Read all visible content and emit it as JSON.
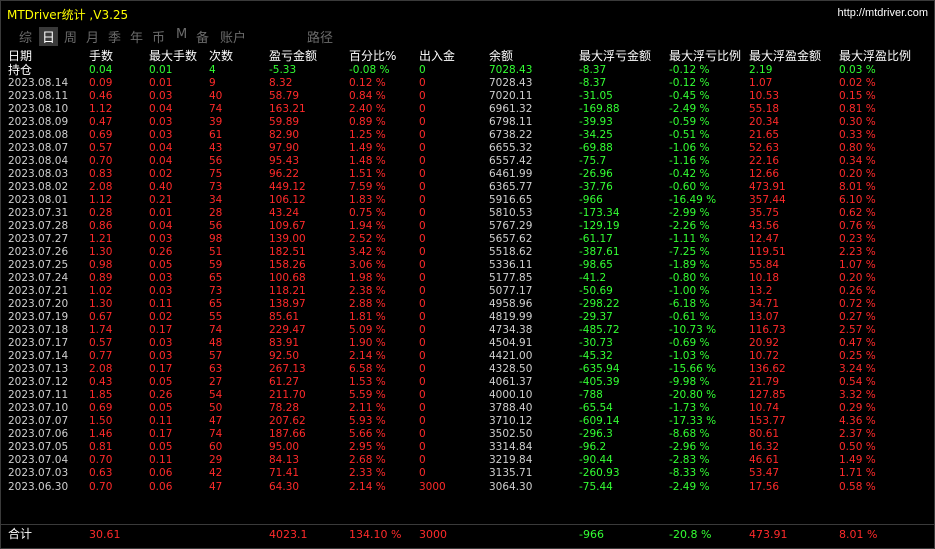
{
  "app": {
    "title": "MTDriver统计 ,V3.25",
    "url": "http://mtdriver.com"
  },
  "tabs": [
    "综",
    "日",
    "周",
    "月",
    "季",
    "年",
    "币",
    "M",
    "备",
    "账户",
    "路径"
  ],
  "active_tab": "日",
  "columns": [
    "日期",
    "手数",
    "最大手数",
    "次数",
    "盈亏金额",
    "百分比%",
    "出入金",
    "余额",
    "最大浮亏金额",
    "最大浮亏比例",
    "最大浮盈金额",
    "最大浮盈比例"
  ],
  "holding": [
    "持仓",
    "0.04",
    "0.01",
    "4",
    "-5.33",
    "-0.08 %",
    "0",
    "7028.43",
    "-8.37",
    "-0.12 %",
    "2.19",
    "0.03 %"
  ],
  "rows": [
    [
      "2023.08.14",
      "0.09",
      "0.01",
      "9",
      "8.32",
      "0.12 %",
      "0",
      "7028.43",
      "-8.37",
      "-0.12 %",
      "1.07",
      "0.02 %"
    ],
    [
      "2023.08.11",
      "0.46",
      "0.03",
      "40",
      "58.79",
      "0.84 %",
      "0",
      "7020.11",
      "-31.05",
      "-0.45 %",
      "10.53",
      "0.15 %"
    ],
    [
      "2023.08.10",
      "1.12",
      "0.04",
      "74",
      "163.21",
      "2.40 %",
      "0",
      "6961.32",
      "-169.88",
      "-2.49 %",
      "55.18",
      "0.81 %"
    ],
    [
      "2023.08.09",
      "0.47",
      "0.03",
      "39",
      "59.89",
      "0.89 %",
      "0",
      "6798.11",
      "-39.93",
      "-0.59 %",
      "20.34",
      "0.30 %"
    ],
    [
      "2023.08.08",
      "0.69",
      "0.03",
      "61",
      "82.90",
      "1.25 %",
      "0",
      "6738.22",
      "-34.25",
      "-0.51 %",
      "21.65",
      "0.33 %"
    ],
    [
      "2023.08.07",
      "0.57",
      "0.04",
      "43",
      "97.90",
      "1.49 %",
      "0",
      "6655.32",
      "-69.88",
      "-1.06 %",
      "52.63",
      "0.80 %"
    ],
    [
      "2023.08.04",
      "0.70",
      "0.04",
      "56",
      "95.43",
      "1.48 %",
      "0",
      "6557.42",
      "-75.7",
      "-1.16 %",
      "22.16",
      "0.34 %"
    ],
    [
      "2023.08.03",
      "0.83",
      "0.02",
      "75",
      "96.22",
      "1.51 %",
      "0",
      "6461.99",
      "-26.96",
      "-0.42 %",
      "12.66",
      "0.20 %"
    ],
    [
      "2023.08.02",
      "2.08",
      "0.40",
      "73",
      "449.12",
      "7.59 %",
      "0",
      "6365.77",
      "-37.76",
      "-0.60 %",
      "473.91",
      "8.01 %"
    ],
    [
      "2023.08.01",
      "1.12",
      "0.21",
      "34",
      "106.12",
      "1.83 %",
      "0",
      "5916.65",
      "-966",
      "-16.49 %",
      "357.44",
      "6.10 %"
    ],
    [
      "2023.07.31",
      "0.28",
      "0.01",
      "28",
      "43.24",
      "0.75 %",
      "0",
      "5810.53",
      "-173.34",
      "-2.99 %",
      "35.75",
      "0.62 %"
    ],
    [
      "2023.07.28",
      "0.86",
      "0.04",
      "56",
      "109.67",
      "1.94 %",
      "0",
      "5767.29",
      "-129.19",
      "-2.26 %",
      "43.56",
      "0.76 %"
    ],
    [
      "2023.07.27",
      "1.21",
      "0.03",
      "98",
      "139.00",
      "2.52 %",
      "0",
      "5657.62",
      "-61.17",
      "-1.11 %",
      "12.47",
      "0.23 %"
    ],
    [
      "2023.07.26",
      "1.30",
      "0.26",
      "51",
      "182.51",
      "3.42 %",
      "0",
      "5518.62",
      "-387.61",
      "-7.25 %",
      "119.51",
      "2.23 %"
    ],
    [
      "2023.07.25",
      "0.98",
      "0.05",
      "59",
      "158.26",
      "3.06 %",
      "0",
      "5336.11",
      "-98.65",
      "-1.89 %",
      "55.84",
      "1.07 %"
    ],
    [
      "2023.07.24",
      "0.89",
      "0.03",
      "65",
      "100.68",
      "1.98 %",
      "0",
      "5177.85",
      "-41.2",
      "-0.80 %",
      "10.18",
      "0.20 %"
    ],
    [
      "2023.07.21",
      "1.02",
      "0.03",
      "73",
      "118.21",
      "2.38 %",
      "0",
      "5077.17",
      "-50.69",
      "-1.00 %",
      "13.2",
      "0.26 %"
    ],
    [
      "2023.07.20",
      "1.30",
      "0.11",
      "65",
      "138.97",
      "2.88 %",
      "0",
      "4958.96",
      "-298.22",
      "-6.18 %",
      "34.71",
      "0.72 %"
    ],
    [
      "2023.07.19",
      "0.67",
      "0.02",
      "55",
      "85.61",
      "1.81 %",
      "0",
      "4819.99",
      "-29.37",
      "-0.61 %",
      "13.07",
      "0.27 %"
    ],
    [
      "2023.07.18",
      "1.74",
      "0.17",
      "74",
      "229.47",
      "5.09 %",
      "0",
      "4734.38",
      "-485.72",
      "-10.73 %",
      "116.73",
      "2.57 %"
    ],
    [
      "2023.07.17",
      "0.57",
      "0.03",
      "48",
      "83.91",
      "1.90 %",
      "0",
      "4504.91",
      "-30.73",
      "-0.69 %",
      "20.92",
      "0.47 %"
    ],
    [
      "2023.07.14",
      "0.77",
      "0.03",
      "57",
      "92.50",
      "2.14 %",
      "0",
      "4421.00",
      "-45.32",
      "-1.03 %",
      "10.72",
      "0.25 %"
    ],
    [
      "2023.07.13",
      "2.08",
      "0.17",
      "63",
      "267.13",
      "6.58 %",
      "0",
      "4328.50",
      "-635.94",
      "-15.66 %",
      "136.62",
      "3.24 %"
    ],
    [
      "2023.07.12",
      "0.43",
      "0.05",
      "27",
      "61.27",
      "1.53 %",
      "0",
      "4061.37",
      "-405.39",
      "-9.98 %",
      "21.79",
      "0.54 %"
    ],
    [
      "2023.07.11",
      "1.85",
      "0.26",
      "54",
      "211.70",
      "5.59 %",
      "0",
      "4000.10",
      "-788",
      "-20.80 %",
      "127.85",
      "3.32 %"
    ],
    [
      "2023.07.10",
      "0.69",
      "0.05",
      "50",
      "78.28",
      "2.11 %",
      "0",
      "3788.40",
      "-65.54",
      "-1.73 %",
      "10.74",
      "0.29 %"
    ],
    [
      "2023.07.07",
      "1.50",
      "0.11",
      "47",
      "207.62",
      "5.93 %",
      "0",
      "3710.12",
      "-609.14",
      "-17.33 %",
      "153.77",
      "4.36 %"
    ],
    [
      "2023.07.06",
      "1.46",
      "0.17",
      "74",
      "187.66",
      "5.66 %",
      "0",
      "3502.50",
      "-296.3",
      "-8.68 %",
      "80.61",
      "2.37 %"
    ],
    [
      "2023.07.05",
      "0.81",
      "0.05",
      "60",
      "95.00",
      "2.95 %",
      "0",
      "3314.84",
      "-96.2",
      "-2.96 %",
      "16.32",
      "0.50 %"
    ],
    [
      "2023.07.04",
      "0.70",
      "0.11",
      "29",
      "84.13",
      "2.68 %",
      "0",
      "3219.84",
      "-90.44",
      "-2.83 %",
      "46.61",
      "1.49 %"
    ],
    [
      "2023.07.03",
      "0.63",
      "0.06",
      "42",
      "71.41",
      "2.33 %",
      "0",
      "3135.71",
      "-260.93",
      "-8.33 %",
      "53.47",
      "1.71 %"
    ],
    [
      "2023.06.30",
      "0.70",
      "0.06",
      "47",
      "64.30",
      "2.14 %",
      "3000",
      "3064.30",
      "-75.44",
      "-2.49 %",
      "17.56",
      "0.58 %"
    ]
  ],
  "total": [
    "合计",
    "30.61",
    "",
    "",
    "4023.1",
    "134.10 %",
    "3000",
    "",
    "-966",
    "-20.8 %",
    "473.91",
    "8.01 %"
  ]
}
